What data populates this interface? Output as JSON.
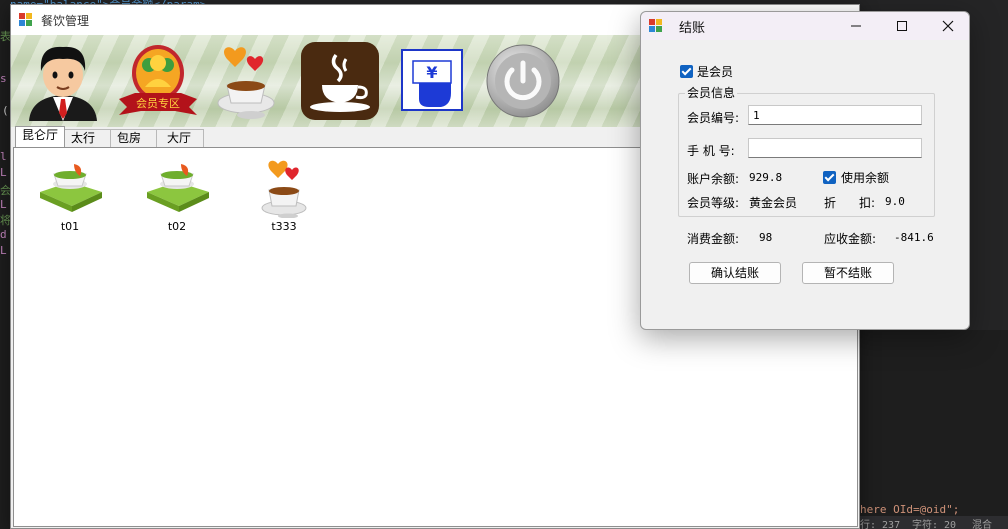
{
  "ide": {
    "fragments": [
      {
        "text": "name=\"balance\">会员余额</param>",
        "color": "#569cd6"
      },
      {
        "text": "表",
        "color": "#6a9955"
      },
      {
        "text": "s",
        "color": "#c586c0"
      },
      {
        "text": "(",
        "color": "#d4d4d4"
      },
      {
        "text": "l",
        "color": "#c586c0"
      },
      {
        "text": "L",
        "color": "#c586c0"
      },
      {
        "text": "会",
        "color": "#6a9955"
      },
      {
        "text": "L",
        "color": "#c586c0"
      },
      {
        "text": "将",
        "color": "#6a9955"
      },
      {
        "text": "d",
        "color": "#c586c0"
      },
      {
        "text": "L",
        "color": "#c586c0"
      },
      {
        "text": "here OId=@oid\";",
        "color": "#ce9178"
      }
    ],
    "status": {
      "line": "行: 237",
      "chars": "字符: 20",
      "mode": "混合"
    }
  },
  "main_window": {
    "title": "餐饮管理",
    "toolbar": [
      {
        "name": "user-management-button",
        "icon": "user-avatar-icon"
      },
      {
        "name": "member-zone-button",
        "icon": "member-badge-icon",
        "caption": "会员专区"
      },
      {
        "name": "menu-management-button",
        "icon": "food-with-hearts-icon"
      },
      {
        "name": "table-management-button",
        "icon": "coffee-cup-icon"
      },
      {
        "name": "checkout-button",
        "icon": "hand-yen-icon",
        "symbol": "¥"
      },
      {
        "name": "exit-button",
        "icon": "power-icon"
      }
    ],
    "tabs": [
      {
        "label": "昆仑厅",
        "active": true
      },
      {
        "label": "太行厅",
        "active": false
      },
      {
        "label": "包房",
        "active": false
      },
      {
        "label": "大厅",
        "active": false
      }
    ],
    "tables": [
      {
        "label": "t01",
        "icon": "table-free-icon"
      },
      {
        "label": "t02",
        "icon": "table-free-icon"
      },
      {
        "label": "t333",
        "icon": "table-occupied-icon"
      }
    ]
  },
  "dialog": {
    "title": "结账",
    "is_member_label": "是会员",
    "is_member_checked": true,
    "group_title": "会员信息",
    "member_id_label": "会员编号:",
    "member_id_value": "1",
    "phone_label": "手 机 号:",
    "phone_value": "",
    "balance_label": "账户余额:",
    "balance_value": "929.8",
    "use_balance_label": "使用余额",
    "use_balance_checked": true,
    "level_label": "会员等级:",
    "level_value": "黄金会员",
    "discount_label_1": "折",
    "discount_label_2": "扣:",
    "discount_value": "9.0",
    "consume_label": "消费金额:",
    "consume_value": "98",
    "payable_label": "应收金额:",
    "payable_value": "-841.6",
    "confirm_button": "确认结账",
    "cancel_button": "暂不结账"
  }
}
